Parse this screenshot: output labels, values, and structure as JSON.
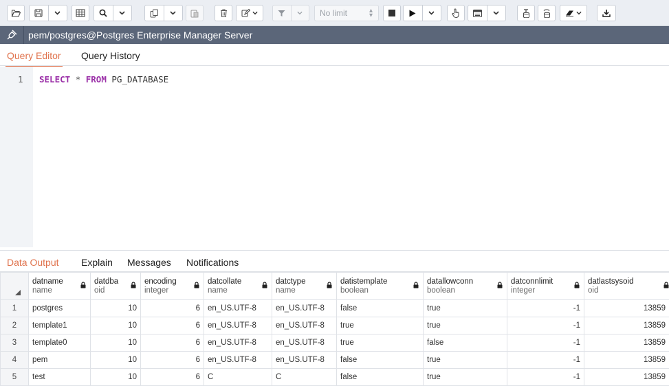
{
  "toolbar": {
    "limit_label": "No limit"
  },
  "connection": {
    "title": "pem/postgres@Postgres Enterprise Manager Server"
  },
  "editor_tabs": [
    {
      "label": "Query Editor",
      "active": true
    },
    {
      "label": "Query History",
      "active": false
    }
  ],
  "editor": {
    "line_number": "1",
    "kw1": "SELECT",
    "star": "*",
    "kw2": "FROM",
    "table": "PG_DATABASE"
  },
  "output_tabs": [
    {
      "label": "Data Output",
      "active": true
    },
    {
      "label": "Explain",
      "active": false
    },
    {
      "label": "Messages",
      "active": false
    },
    {
      "label": "Notifications",
      "active": false
    }
  ],
  "grid": {
    "columns": [
      {
        "name": "datname",
        "type": "name"
      },
      {
        "name": "datdba",
        "type": "oid"
      },
      {
        "name": "encoding",
        "type": "integer"
      },
      {
        "name": "datcollate",
        "type": "name"
      },
      {
        "name": "datctype",
        "type": "name"
      },
      {
        "name": "datistemplate",
        "type": "boolean"
      },
      {
        "name": "datallowconn",
        "type": "boolean"
      },
      {
        "name": "datconnlimit",
        "type": "integer"
      },
      {
        "name": "datlastsysoid",
        "type": "oid"
      }
    ],
    "rows": [
      {
        "n": "1",
        "cells": [
          "postgres",
          "10",
          "6",
          "en_US.UTF-8",
          "en_US.UTF-8",
          "false",
          "true",
          "-1",
          "13859"
        ]
      },
      {
        "n": "2",
        "cells": [
          "template1",
          "10",
          "6",
          "en_US.UTF-8",
          "en_US.UTF-8",
          "true",
          "true",
          "-1",
          "13859"
        ]
      },
      {
        "n": "3",
        "cells": [
          "template0",
          "10",
          "6",
          "en_US.UTF-8",
          "en_US.UTF-8",
          "true",
          "false",
          "-1",
          "13859"
        ]
      },
      {
        "n": "4",
        "cells": [
          "pem",
          "10",
          "6",
          "en_US.UTF-8",
          "en_US.UTF-8",
          "false",
          "true",
          "-1",
          "13859"
        ]
      },
      {
        "n": "5",
        "cells": [
          "test",
          "10",
          "6",
          "C",
          "C",
          "false",
          "true",
          "-1",
          "13859"
        ]
      }
    ]
  },
  "colors": {
    "accent": "#e0734d",
    "connection_bar": "#5b6679",
    "keyword": "#9b30a8"
  }
}
